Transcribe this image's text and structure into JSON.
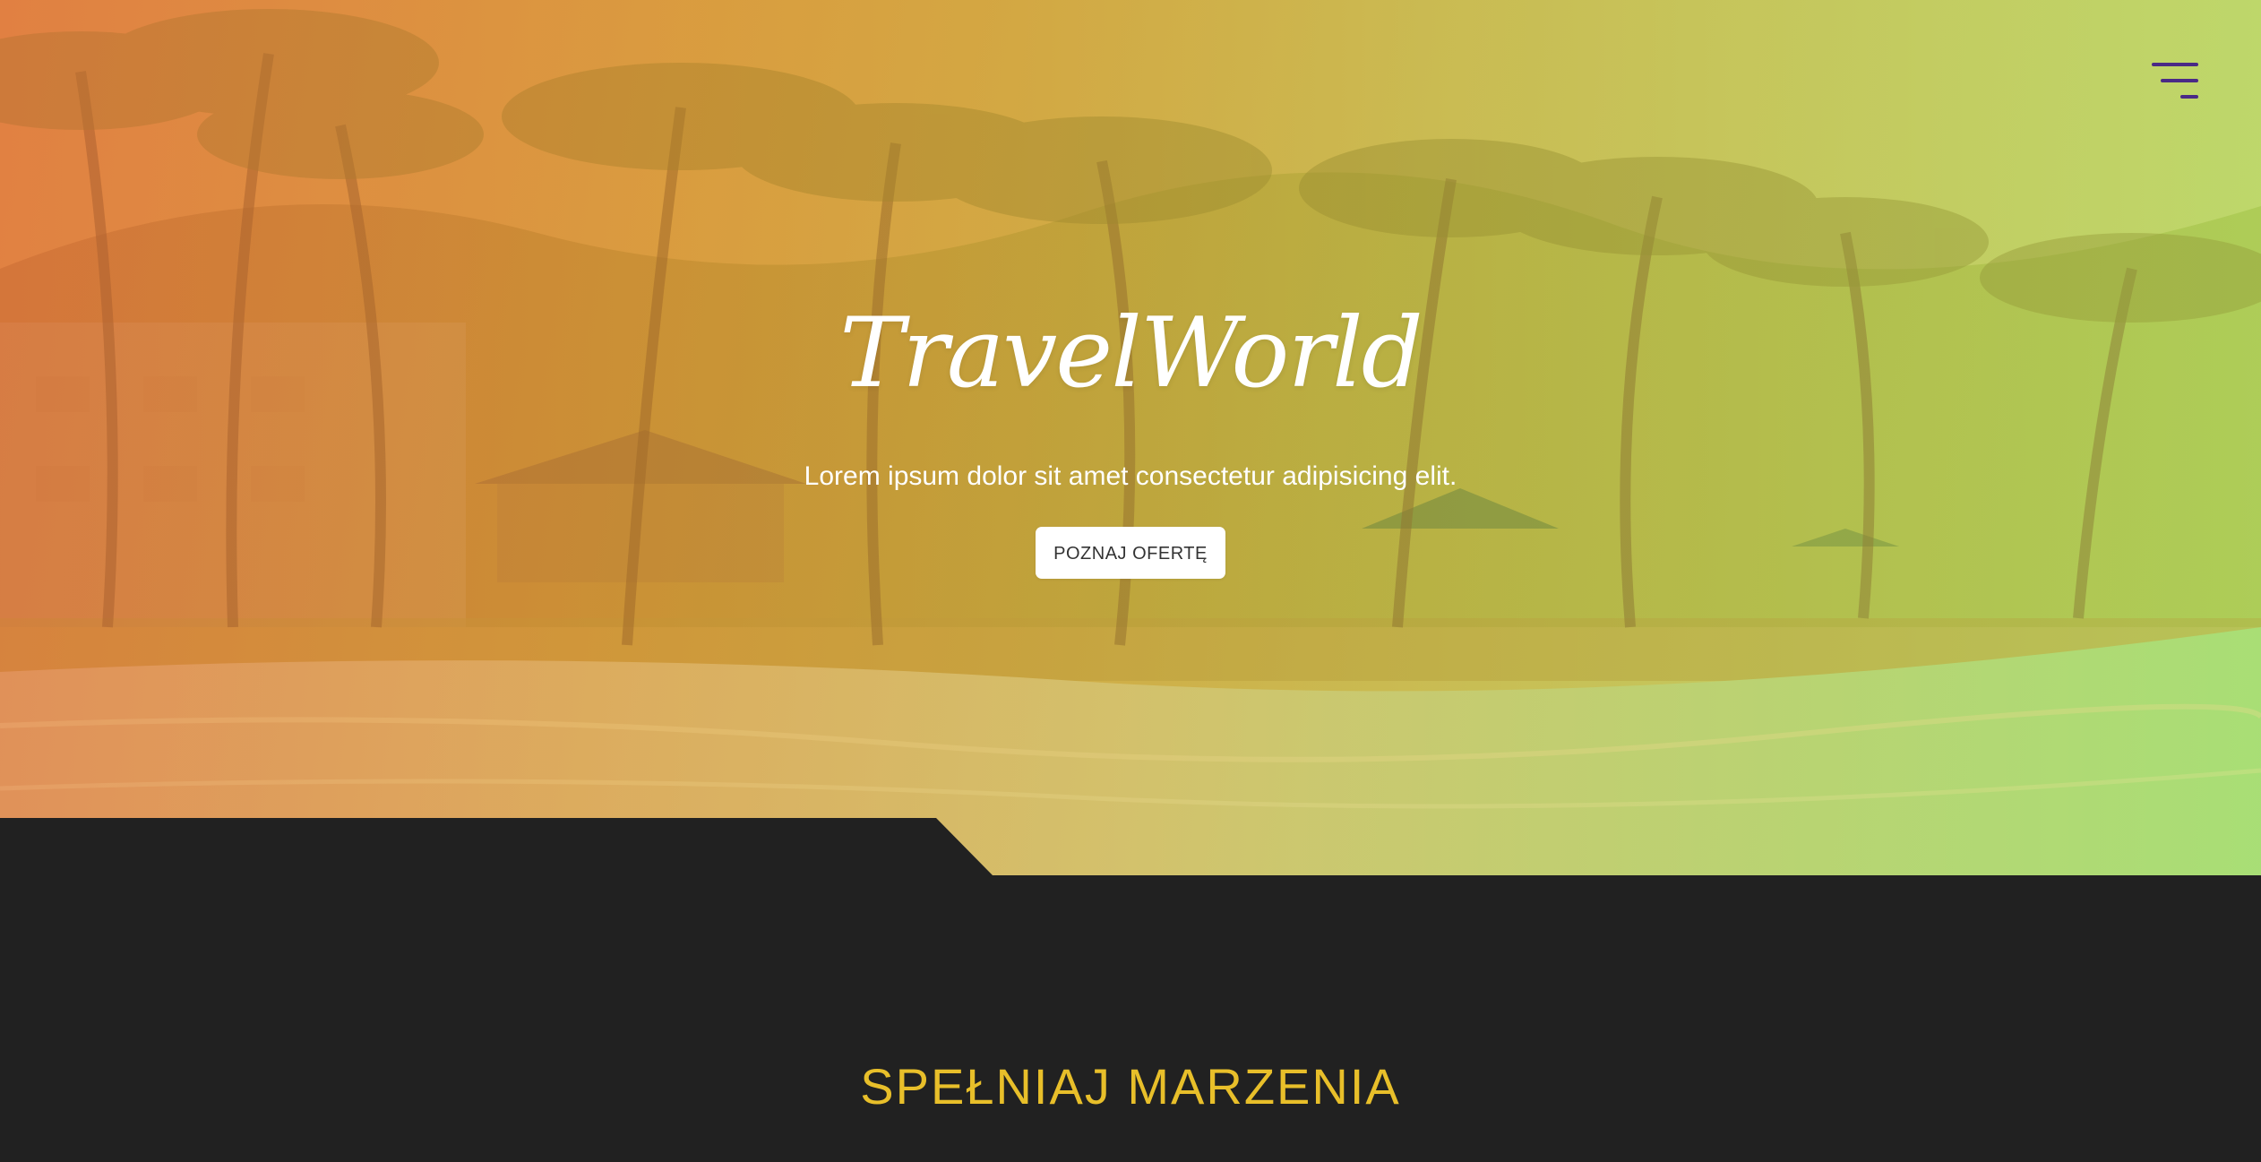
{
  "hero": {
    "brand": "TravelWorld",
    "tagline": "Lorem ipsum dolor sit amet consectetur adipisicing elit.",
    "cta_label": "POZNAJ OFERTĘ",
    "menu_icon": "hamburger-menu-icon"
  },
  "section": {
    "title": "SPEŁNIAJ MARZENIA"
  },
  "colors": {
    "accent": "#e8bf2a",
    "menu_icon": "#4a2a86",
    "dark_background": "#212121",
    "button_background": "#ffffff"
  }
}
